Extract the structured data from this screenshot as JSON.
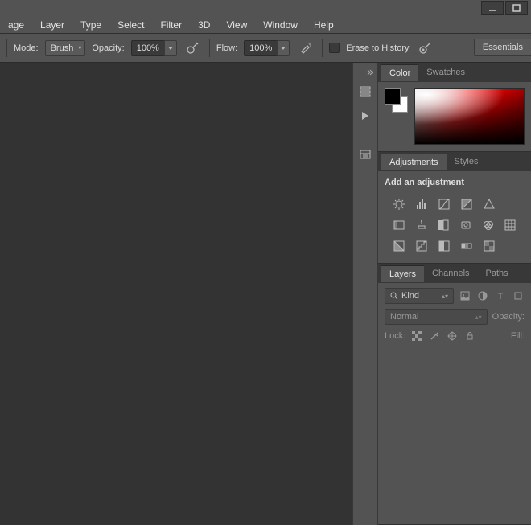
{
  "menu": [
    "age",
    "Layer",
    "Type",
    "Select",
    "Filter",
    "3D",
    "View",
    "Window",
    "Help"
  ],
  "options": {
    "mode_label": "Mode:",
    "mode_value": "Brush",
    "opacity_label": "Opacity:",
    "opacity_value": "100%",
    "flow_label": "Flow:",
    "flow_value": "100%",
    "erase_history_label": "Erase to History",
    "essentials": "Essentials"
  },
  "panels": {
    "color_tab": "Color",
    "swatches_tab": "Swatches",
    "adjustments_tab": "Adjustments",
    "styles_tab": "Styles",
    "add_adjustment": "Add an adjustment",
    "layers_tab": "Layers",
    "channels_tab": "Channels",
    "paths_tab": "Paths",
    "kind_label": "Kind",
    "blend_mode": "Normal",
    "opacity_panel_label": "Opacity:",
    "lock_label": "Lock:",
    "fill_label": "Fill:"
  }
}
